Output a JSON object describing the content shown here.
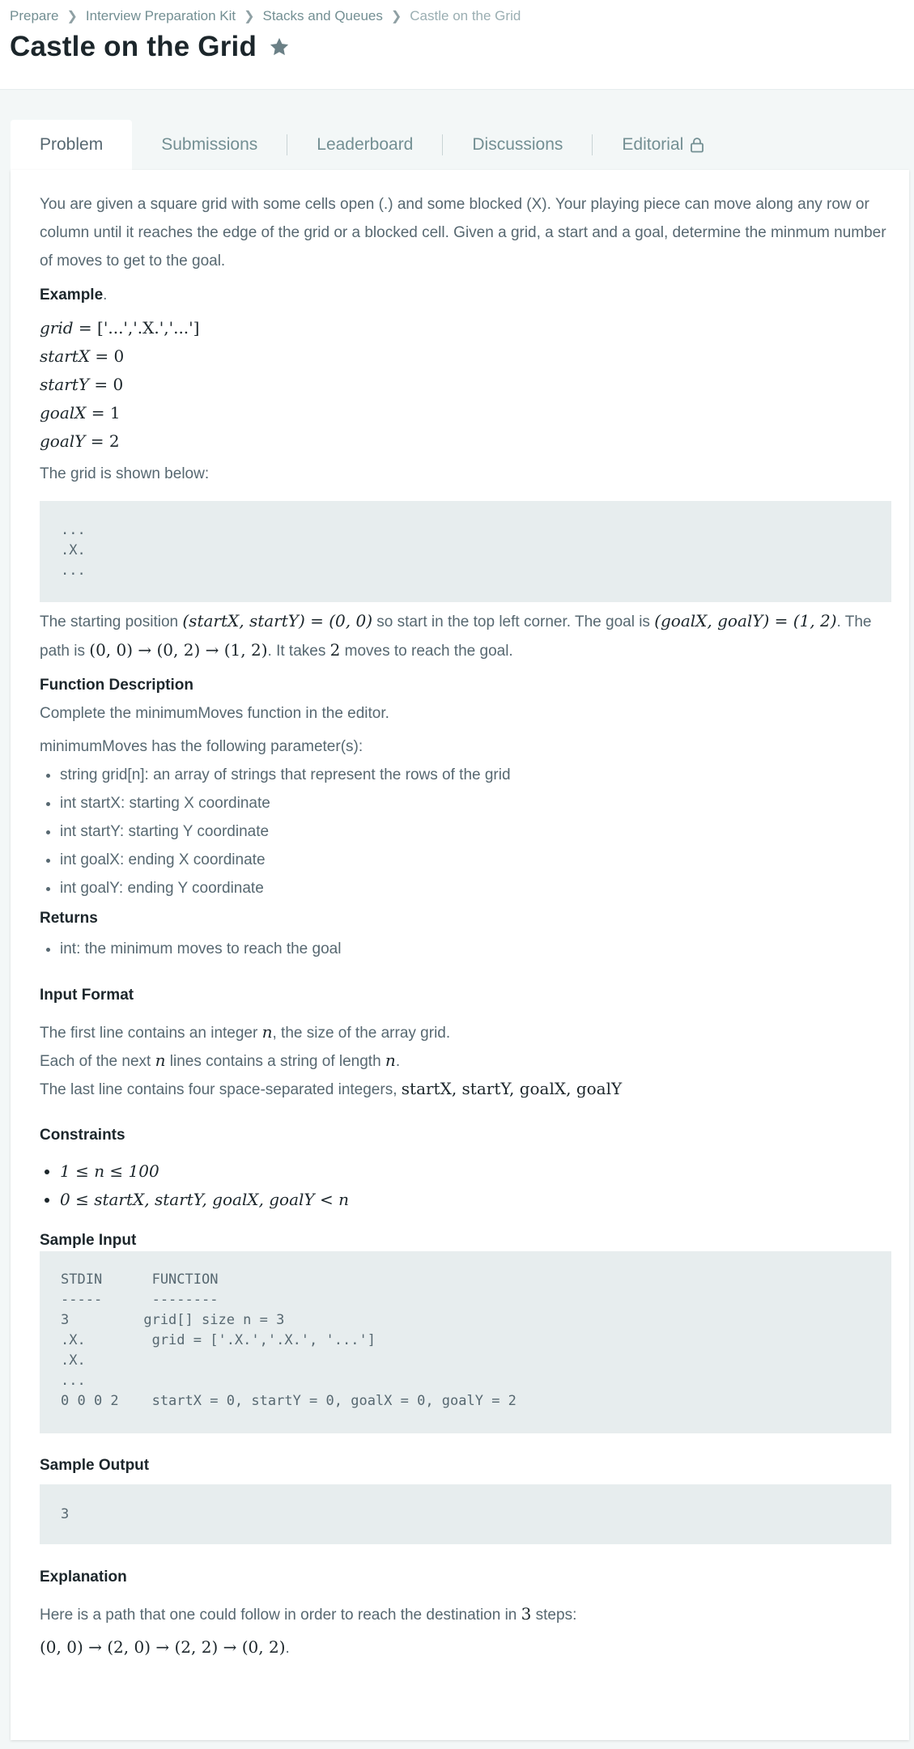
{
  "breadcrumb": [
    "Prepare",
    "Interview Preparation Kit",
    "Stacks and Queues",
    "Castle on the Grid"
  ],
  "title": "Castle on the Grid",
  "tabs": [
    "Problem",
    "Submissions",
    "Leaderboard",
    "Discussions",
    "Editorial"
  ],
  "intro": "You are given a square grid with some cells open (.) and some blocked (X). Your playing piece can move along any row or column until it reaches the edge of the grid or a blocked cell. Given a grid, a start and a goal, determine the minmum number of moves to get to the goal.",
  "example_heading": "Example",
  "example_vars": [
    {
      "name": "grid",
      "value": "['...','.X.','...']"
    },
    {
      "name": "startX",
      "value": "0"
    },
    {
      "name": "startY",
      "value": "0"
    },
    {
      "name": "goalX",
      "value": "1"
    },
    {
      "name": "goalY",
      "value": "2"
    }
  ],
  "grid_shown": "The grid is shown below:",
  "grid_code": "...\n.X.\n...",
  "start_text": {
    "a": "The starting position ",
    "b": "(startX, startY) = (0, 0)",
    "c": " so start in the top left corner. The goal is ",
    "d": "(goalX, goalY) = (1, 2)",
    "e": ". The",
    "f": "path is ",
    "g": "(0, 0) → (0, 2) → (1, 2)",
    "h": ". It takes ",
    "i": "2",
    "j": " moves to reach the goal."
  },
  "function_description": {
    "heading": "Function Description",
    "complete": "Complete the minimumMoves function in the editor.",
    "params_intro": "minimumMoves has the following parameter(s):",
    "params": [
      "string grid[n]: an array of strings that represent the rows of the grid",
      "int startX: starting X coordinate",
      "int startY: starting Y coordinate",
      "int goalX: ending X coordinate",
      "int goalY: ending Y coordinate"
    ]
  },
  "returns": {
    "heading": "Returns",
    "items": [
      "int: the minimum moves to reach the goal"
    ]
  },
  "input_format": {
    "heading": "Input Format",
    "line1a": "The first line contains an integer ",
    "line1b": "n",
    "line1c": ", the size of the array grid.",
    "line2a": "Each of the next ",
    "line2b": "n",
    "line2c": " lines contains a string of length ",
    "line2d": "n",
    "line2e": ".",
    "line3a": "The last line contains four space-separated integers, ",
    "line3b": "startX, startY, goalX, goalY"
  },
  "constraints": {
    "heading": "Constraints",
    "items": [
      "1 ≤ n ≤ 100",
      "0 ≤ startX, startY, goalX, goalY < n"
    ]
  },
  "sample_input": {
    "heading": "Sample Input",
    "code": "STDIN      FUNCTION\n-----      --------\n3         grid[] size n = 3\n.X.        grid = ['.X.','.X.', '...']\n.X.\n...\n0 0 0 2    startX = 0, startY = 0, goalX = 0, goalY = 2"
  },
  "sample_output": {
    "heading": "Sample Output",
    "code": "3"
  },
  "explanation": {
    "heading": "Explanation",
    "text_a": "Here is a path that one could follow in order to reach the destination in ",
    "text_b": "3",
    "text_c": " steps:",
    "path": "(0, 0) → (2, 0) → (2, 2) → (0, 2)",
    "path_end": "."
  },
  "colors": {
    "title": "#1c262b",
    "text": "#576871",
    "muted": "#738f93",
    "code_bg": "#e7edee",
    "page_bg": "#f3f7f7"
  }
}
